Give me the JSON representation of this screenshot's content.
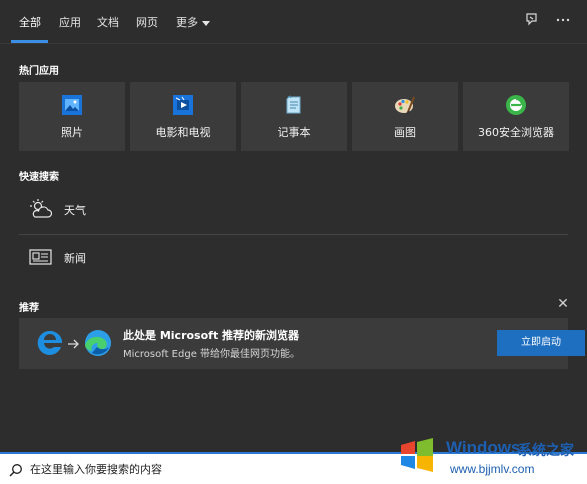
{
  "tabs": {
    "items": [
      "全部",
      "应用",
      "文档",
      "网页",
      "更多"
    ],
    "active_index": 0
  },
  "sections": {
    "top_apps": "热门应用",
    "quick_search": "快速搜索",
    "recommend": "推荐"
  },
  "apps": [
    {
      "label": "照片",
      "icon": "photos-icon"
    },
    {
      "label": "电影和电视",
      "icon": "movies-tv-icon"
    },
    {
      "label": "记事本",
      "icon": "notepad-icon"
    },
    {
      "label": "画图",
      "icon": "paint-icon"
    },
    {
      "label": "360安全浏览器",
      "icon": "360-browser-icon"
    }
  ],
  "quick": [
    {
      "label": "天气",
      "icon": "weather-icon"
    },
    {
      "label": "新闻",
      "icon": "news-icon"
    }
  ],
  "recommend": {
    "title": "此处是 Microsoft 推荐的新浏览器",
    "subtitle": "Microsoft Edge 带给你最佳网页功能。",
    "button": "立即启动"
  },
  "search": {
    "placeholder": "在这里输入你要搜索的内容"
  },
  "watermark": {
    "brand": "Windows",
    "cn": "系统之家",
    "url": "www.bjjmlv.com"
  },
  "colors": {
    "accent": "#3a8ee6",
    "button": "#1f6fc0",
    "panel": "#2d2d2d",
    "tile": "#3b3b3b"
  }
}
